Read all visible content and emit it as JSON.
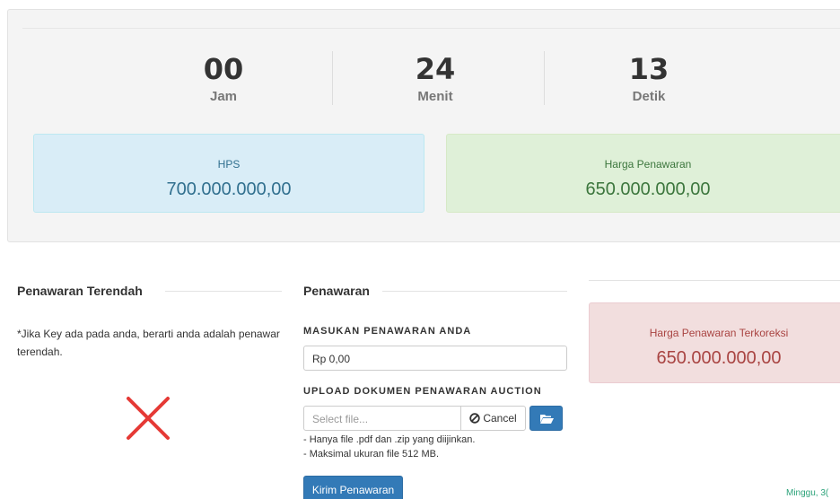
{
  "countdown": [
    {
      "value": "00",
      "unit": "Jam"
    },
    {
      "value": "24",
      "unit": "Menit"
    },
    {
      "value": "13",
      "unit": "Detik"
    }
  ],
  "hps": {
    "label": "HPS",
    "amount": "700.000.000,00"
  },
  "harga_penawaran": {
    "label": "Harga Penawaran",
    "amount": "650.000.000,00"
  },
  "terendah": {
    "title": "Penawaran Terendah",
    "note": "*Jika Key ada pada anda, berarti anda adalah penawar terendah.",
    "status_icon": "x-mark-icon"
  },
  "penawaran": {
    "title": "Penawaran",
    "input_label": "MASUKAN PENAWARAN ANDA",
    "input_value": "Rp 0,00",
    "upload_label": "UPLOAD DOKUMEN PENAWARAN AUCTION",
    "file_placeholder": "Select file...",
    "cancel_label": "Cancel",
    "hint_1": "- Hanya file .pdf dan .zip yang diijinkan.",
    "hint_2": "- Maksimal ukuran file 512 MB.",
    "submit_label": "Kirim Penawaran"
  },
  "terkoreksi": {
    "label": "Harga Penawaran Terkoreksi",
    "amount": "650.000.000,00"
  },
  "footer": {
    "date": "Minggu, 3("
  },
  "colors": {
    "primary": "#337ab7",
    "info_bg": "#d9edf7",
    "success_bg": "#dff0d8",
    "danger_bg": "#f2dede",
    "x_mark": "#e53935"
  }
}
